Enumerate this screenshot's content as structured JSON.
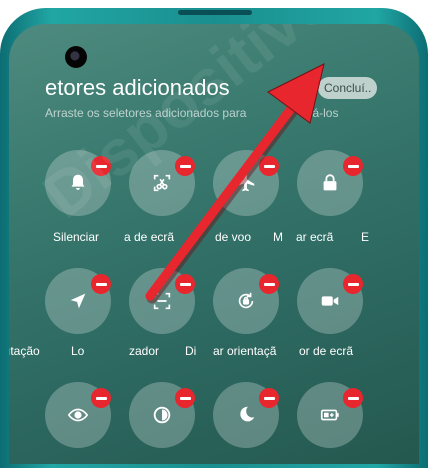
{
  "header": {
    "title": "etores adicionados",
    "subtitle": "Arraste os seletores adicionados para",
    "subtitle_tail": "ná-los",
    "done_label": "Concluí.."
  },
  "tiles": [
    {
      "icon": "bell-icon",
      "label": "Silenciar"
    },
    {
      "icon": "screenshot-icon",
      "label": "a de ecrã"
    },
    {
      "icon": "airplane-icon",
      "label": "de voo"
    },
    {
      "icon": "lock-icon",
      "label": "ar ecrã"
    },
    {
      "icon": "location-icon",
      "label": "Lo"
    },
    {
      "icon": "scanner-icon",
      "label": "zador"
    },
    {
      "icon": "rotate-icon",
      "label": "ar orientaçã"
    },
    {
      "icon": "camera-video-icon",
      "label": "or de ecrã"
    },
    {
      "icon": "eye-icon",
      "label": ""
    },
    {
      "icon": "contrast-icon",
      "label": ""
    },
    {
      "icon": "moon-icon",
      "label": ""
    },
    {
      "icon": "battery-icon",
      "label": ""
    }
  ],
  "edge_labels": {
    "row1_left": "",
    "row1_mid": "M",
    "row1_right": "E",
    "row2_left": "ıtação",
    "row2_mid": "Di"
  },
  "colors": {
    "remove_badge": "#e8262e",
    "arrow": "#e8262e",
    "phone_frame": "#1a8f8f"
  },
  "watermark": "Dispositivos.pt"
}
